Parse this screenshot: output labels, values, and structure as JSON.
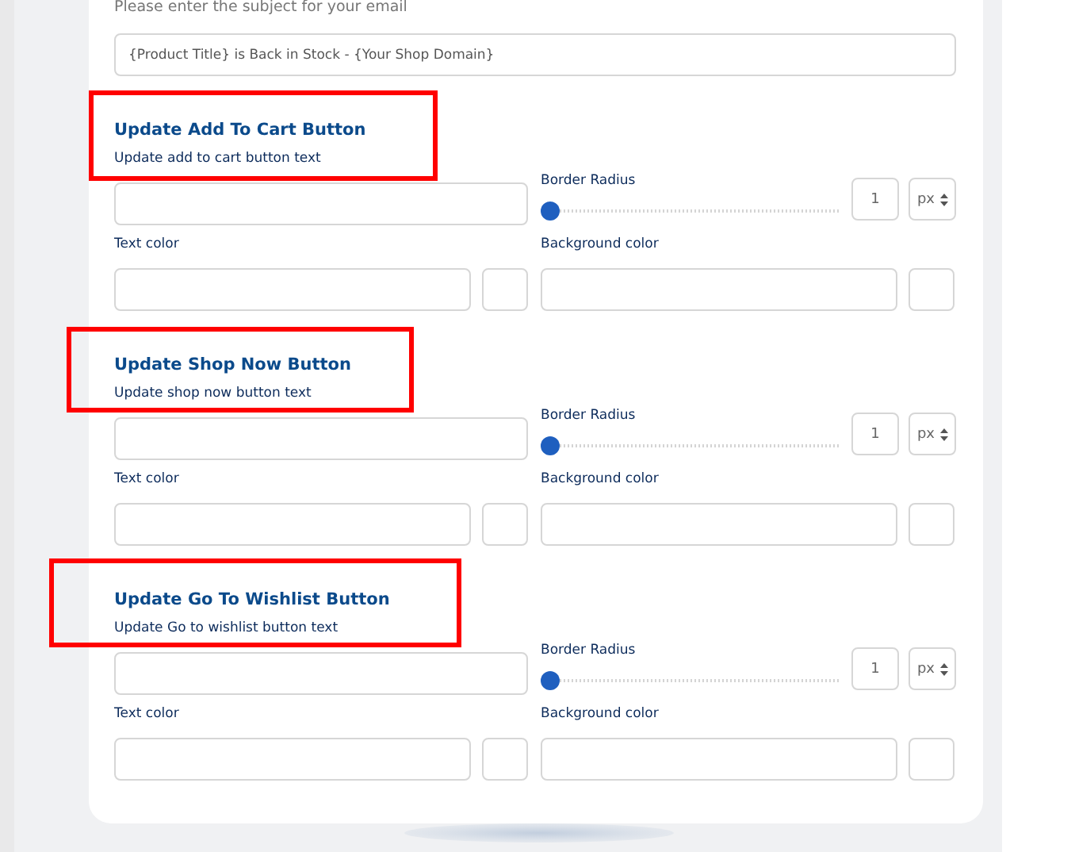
{
  "subject": {
    "label": "Please enter the subject for your email",
    "value": "{Product Title} is Back in Stock - {Your Shop Domain}"
  },
  "sections": [
    {
      "title": "Update Add To Cart Button",
      "subtitle": "Update add to cart button text",
      "highlighted": true,
      "radius_label": "Border Radius",
      "level": 0,
      "radius_value": "1",
      "unit": "px",
      "text_color_label": "Text color",
      "background_color_label": "Background color"
    },
    {
      "title": "Update Shop Now Button",
      "subtitle": "Update shop now button text",
      "highlighted": true,
      "radius_label": "Border Radius",
      "level": 0,
      "radius_value": "1",
      "unit": "px",
      "text_color_label": "Text color",
      "background_color_label": "Background color"
    },
    {
      "title": "Update Go To Wishlist Button",
      "subtitle": "Update Go to wishlist button text",
      "highlighted": true,
      "radius_label": "Border Radius",
      "level": 0,
      "radius_value": "1",
      "unit": "px",
      "text_color_label": "Text color",
      "background_color_label": "Background color"
    }
  ]
}
